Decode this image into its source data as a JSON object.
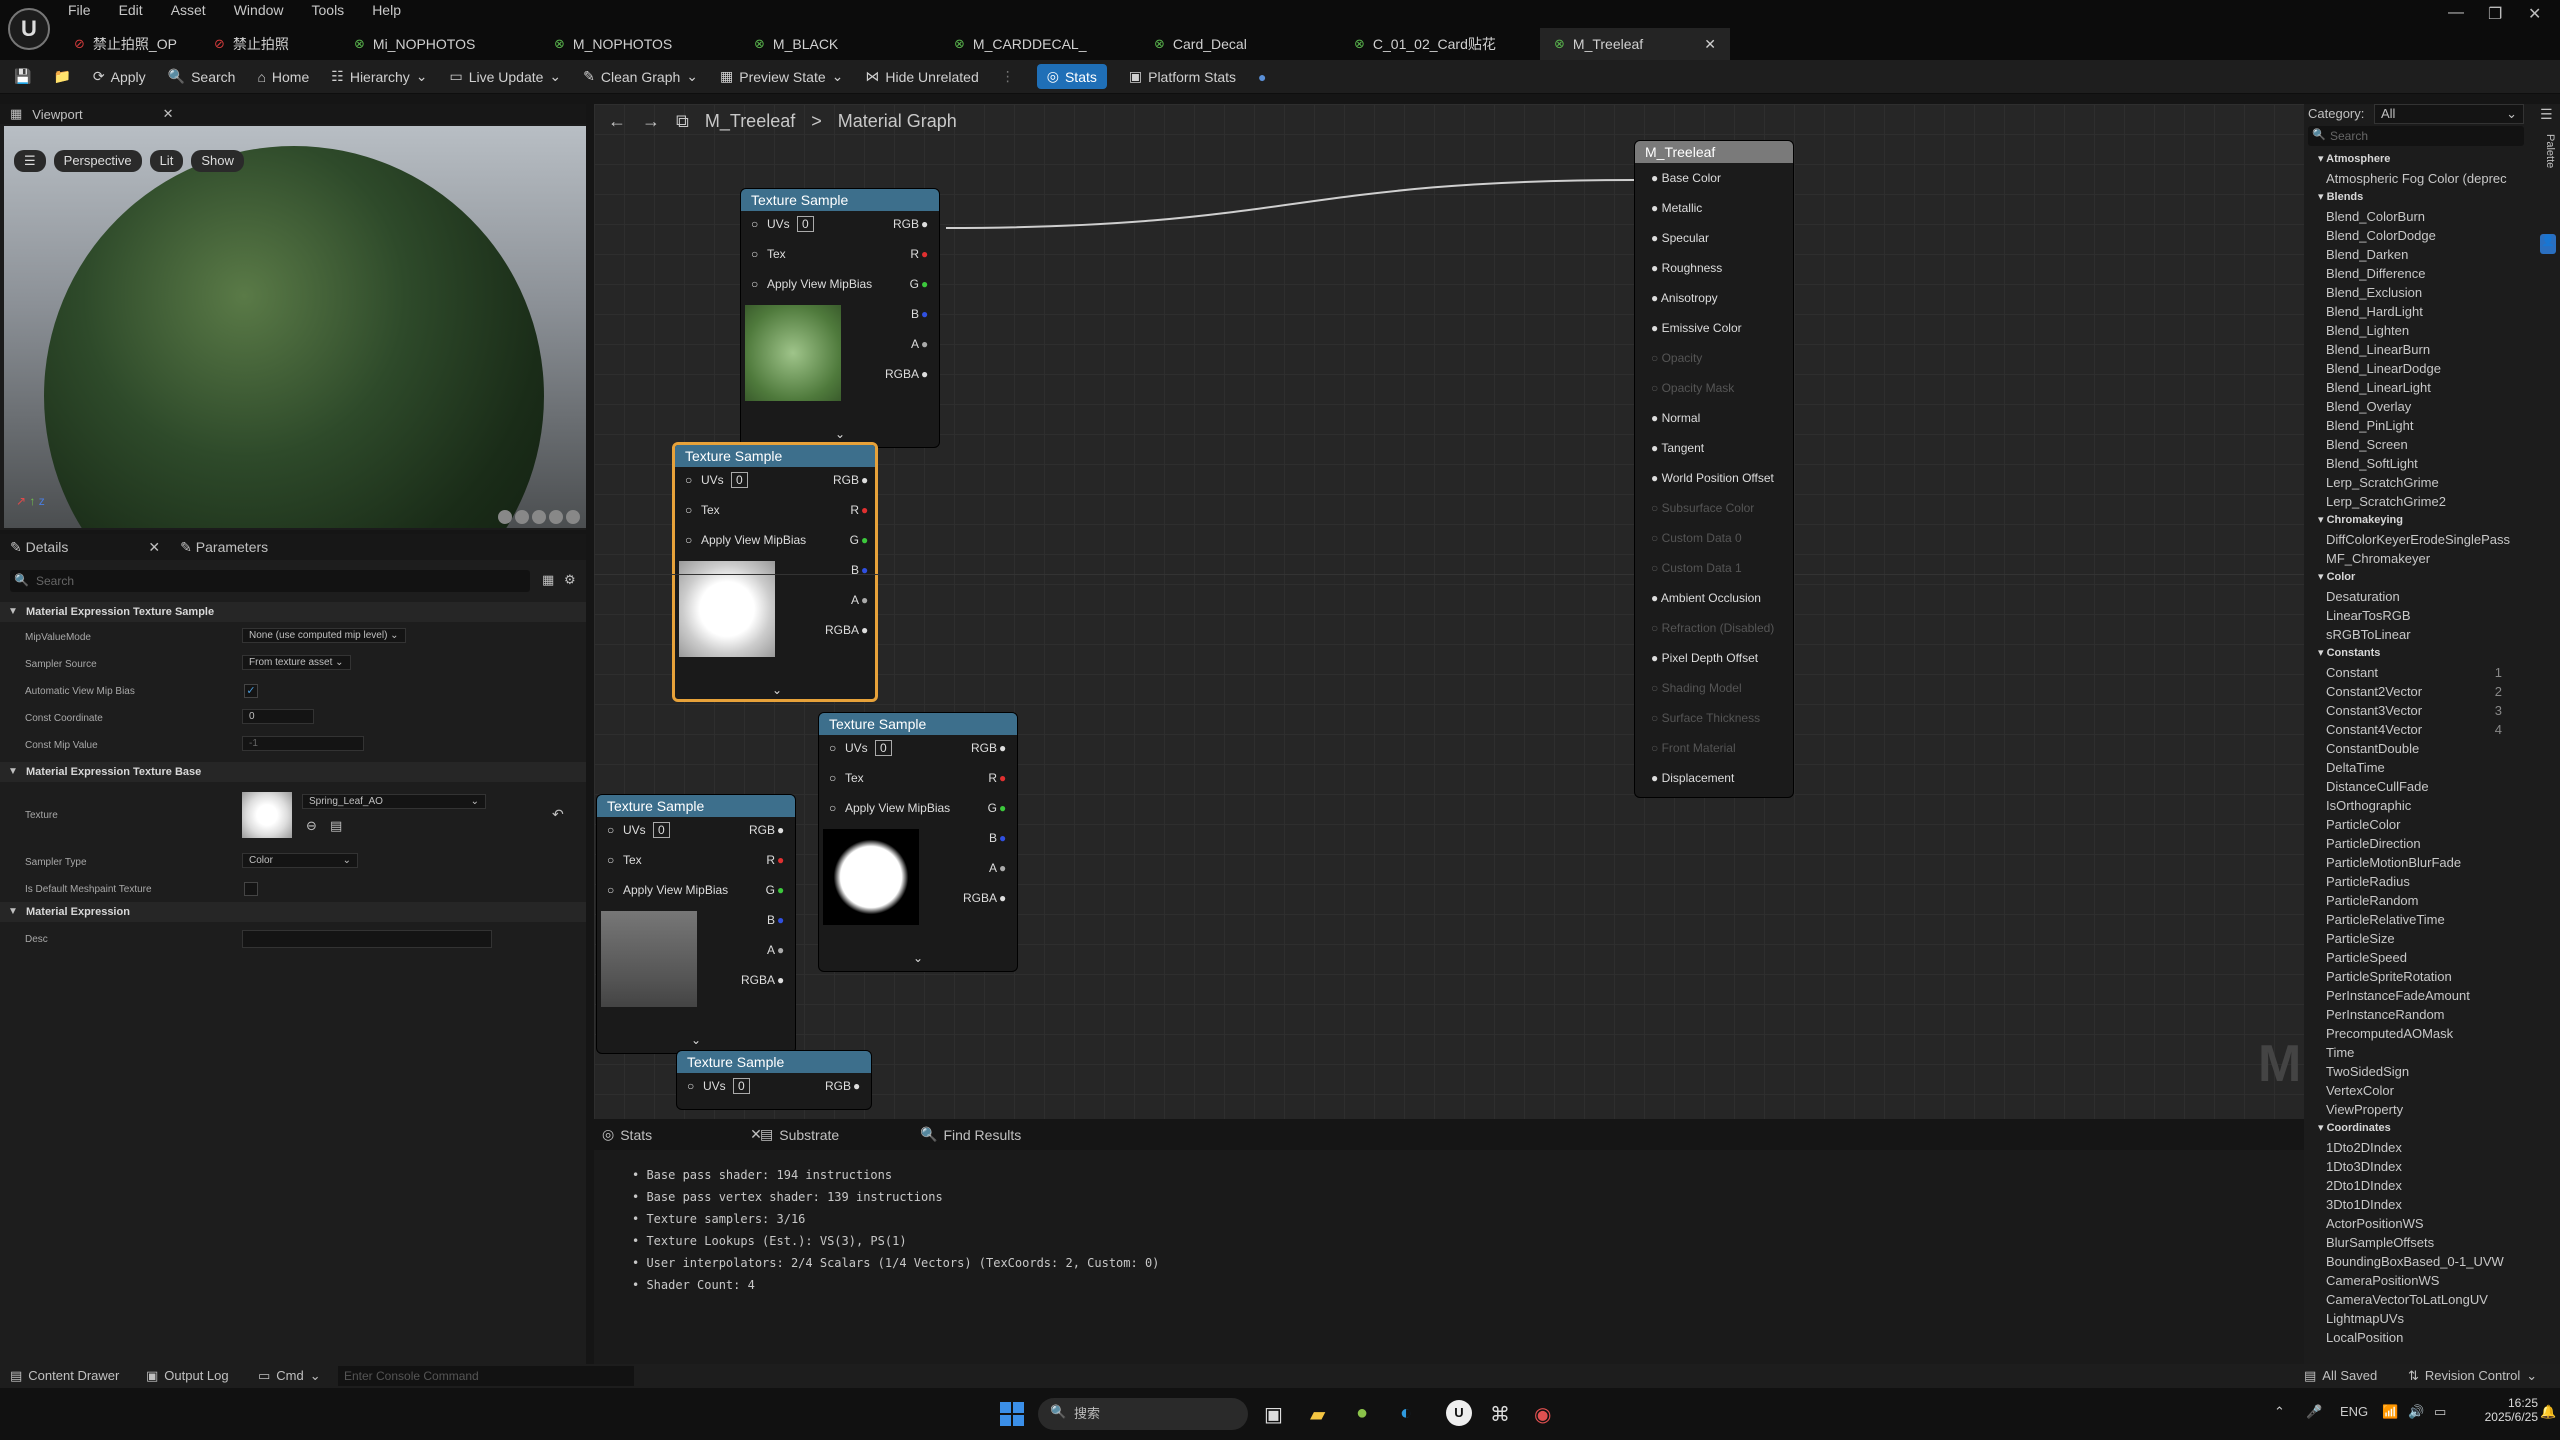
{
  "menu": [
    "File",
    "Edit",
    "Asset",
    "Window",
    "Tools",
    "Help"
  ],
  "doc_tabs": [
    {
      "label": "禁止拍照_OP",
      "icon": "red-icon"
    },
    {
      "label": "禁止拍照",
      "icon": "red-icon"
    },
    {
      "label": "Mi_NOPHOTOS",
      "icon": "green-icon"
    },
    {
      "label": "M_NOPHOTOS",
      "icon": "green-icon"
    },
    {
      "label": "M_BLACK",
      "icon": "green-icon"
    },
    {
      "label": "M_CARDDECAL_",
      "icon": "green-icon"
    },
    {
      "label": "Card_Decal",
      "icon": "green-icon"
    },
    {
      "label": "C_01_02_Card贴花",
      "icon": "green-icon"
    },
    {
      "label": "M_Treeleaf",
      "icon": "green-icon"
    }
  ],
  "toolbar": {
    "apply": "Apply",
    "search": "Search",
    "home": "Home",
    "hierarchy": "Hierarchy",
    "live_update": "Live Update",
    "clean_graph": "Clean Graph",
    "preview_state": "Preview State",
    "hide_unrelated": "Hide Unrelated",
    "stats": "Stats",
    "platform_stats": "Platform Stats"
  },
  "viewport": {
    "title": "Viewport",
    "perspective": "Perspective",
    "lit": "Lit",
    "show": "Show"
  },
  "details": {
    "tab1": "Details",
    "tab2": "Parameters",
    "search_placeholder": "Search",
    "sec1": "Material Expression Texture Sample",
    "mip_value_mode_label": "MipValueMode",
    "mip_value_mode": "None (use computed mip level)",
    "sampler_source_label": "Sampler Source",
    "sampler_source": "From texture asset",
    "auto_mip_label": "Automatic View Mip Bias",
    "const_coord_label": "Const Coordinate",
    "const_coord": "0",
    "const_mip_label": "Const Mip Value",
    "const_mip": "-1",
    "sec2": "Material Expression Texture Base",
    "texture_label": "Texture",
    "texture": "Spring_Leaf_AO",
    "sampler_type_label": "Sampler Type",
    "sampler_type": "Color",
    "default_meshpaint_label": "Is Default Meshpaint Texture",
    "sec3": "Material Expression",
    "desc_label": "Desc"
  },
  "graph": {
    "title": "M_Treeleaf",
    "subtitle": "Material Graph",
    "watermark": "M"
  },
  "node": {
    "title": "Texture Sample",
    "uvs": "UVs",
    "uv_index": "0",
    "tex": "Tex",
    "mipbias": "Apply View MipBias",
    "outputs": [
      "RGB",
      "R",
      "G",
      "B",
      "A",
      "RGBA"
    ]
  },
  "output_node": {
    "title": "M_Treeleaf",
    "inputs": [
      {
        "label": "Base Color",
        "enabled": true
      },
      {
        "label": "Metallic",
        "enabled": true
      },
      {
        "label": "Specular",
        "enabled": true
      },
      {
        "label": "Roughness",
        "enabled": true
      },
      {
        "label": "Anisotropy",
        "enabled": true
      },
      {
        "label": "Emissive Color",
        "enabled": true
      },
      {
        "label": "Opacity",
        "enabled": false
      },
      {
        "label": "Opacity Mask",
        "enabled": false
      },
      {
        "label": "Normal",
        "enabled": true
      },
      {
        "label": "Tangent",
        "enabled": true
      },
      {
        "label": "World Position Offset",
        "enabled": true
      },
      {
        "label": "Subsurface Color",
        "enabled": false
      },
      {
        "label": "Custom Data 0",
        "enabled": false
      },
      {
        "label": "Custom Data 1",
        "enabled": false
      },
      {
        "label": "Ambient Occlusion",
        "enabled": true
      },
      {
        "label": "Refraction (Disabled)",
        "enabled": false
      },
      {
        "label": "Pixel Depth Offset",
        "enabled": true
      },
      {
        "label": "Shading Model",
        "enabled": false
      },
      {
        "label": "Surface Thickness",
        "enabled": false
      },
      {
        "label": "Front Material",
        "enabled": false
      },
      {
        "label": "Displacement",
        "enabled": true
      }
    ]
  },
  "stats_panel": {
    "tab1": "Stats",
    "tab2": "Substrate",
    "tab3": "Find Results",
    "lines": [
      "Base pass shader: 194 instructions",
      "Base pass vertex shader: 139 instructions",
      "Texture samplers: 3/16",
      "Texture Lookups (Est.): VS(3), PS(1)",
      "User interpolators: 2/4 Scalars (1/4 Vectors) (TexCoords: 2, Custom: 0)",
      "Shader Count: 4"
    ]
  },
  "palette": {
    "category_label": "Category:",
    "category": "All",
    "search_placeholder": "Search",
    "side_label": "Palette",
    "groups": [
      {
        "name": "Atmosphere",
        "items": [
          "Atmospheric Fog Color (deprec"
        ]
      },
      {
        "name": "Blends",
        "items": [
          "Blend_ColorBurn",
          "Blend_ColorDodge",
          "Blend_Darken",
          "Blend_Difference",
          "Blend_Exclusion",
          "Blend_HardLight",
          "Blend_Lighten",
          "Blend_LinearBurn",
          "Blend_LinearDodge",
          "Blend_LinearLight",
          "Blend_Overlay",
          "Blend_PinLight",
          "Blend_Screen",
          "Blend_SoftLight",
          "Lerp_ScratchGrime",
          "Lerp_ScratchGrime2"
        ]
      },
      {
        "name": "Chromakeying",
        "items": [
          "DiffColorKeyerErodeSinglePass",
          "MF_Chromakeyer"
        ]
      },
      {
        "name": "Color",
        "items": [
          "Desaturation",
          "LinearTosRGB",
          "sRGBToLinear"
        ]
      },
      {
        "name": "Constants",
        "items": [
          "Constant",
          "Constant2Vector",
          "Constant3Vector",
          "Constant4Vector",
          "ConstantDouble",
          "DeltaTime",
          "DistanceCullFade",
          "IsOrthographic",
          "ParticleColor",
          "ParticleDirection",
          "ParticleMotionBlurFade",
          "ParticleRadius",
          "ParticleRandom",
          "ParticleRelativeTime",
          "ParticleSize",
          "ParticleSpeed",
          "ParticleSpriteRotation",
          "PerInstanceFadeAmount",
          "PerInstanceRandom",
          "PrecomputedAOMask",
          "Time",
          "TwoSidedSign",
          "VertexColor",
          "ViewProperty"
        ]
      },
      {
        "name": "Coordinates",
        "items": [
          "1Dto2DIndex",
          "1Dto3DIndex",
          "2Dto1DIndex",
          "3Dto1DIndex",
          "ActorPositionWS",
          "BlurSampleOffsets",
          "BoundingBoxBased_0-1_UVW",
          "CameraPositionWS",
          "CameraVectorToLatLongUV",
          "LightmapUVs",
          "LocalPosition"
        ]
      }
    ],
    "shortcuts": {
      "Constant": "1",
      "Constant2Vector": "2",
      "Constant3Vector": "3",
      "Constant4Vector": "4"
    }
  },
  "bottom": {
    "content_drawer": "Content Drawer",
    "output_log": "Output Log",
    "cmd": "Cmd",
    "console_placeholder": "Enter Console Command",
    "all_saved": "All Saved",
    "revision": "Revision Control"
  },
  "taskbar": {
    "search": "搜索",
    "lang": "ENG",
    "time": "16:25",
    "date": "2025/6/25"
  }
}
